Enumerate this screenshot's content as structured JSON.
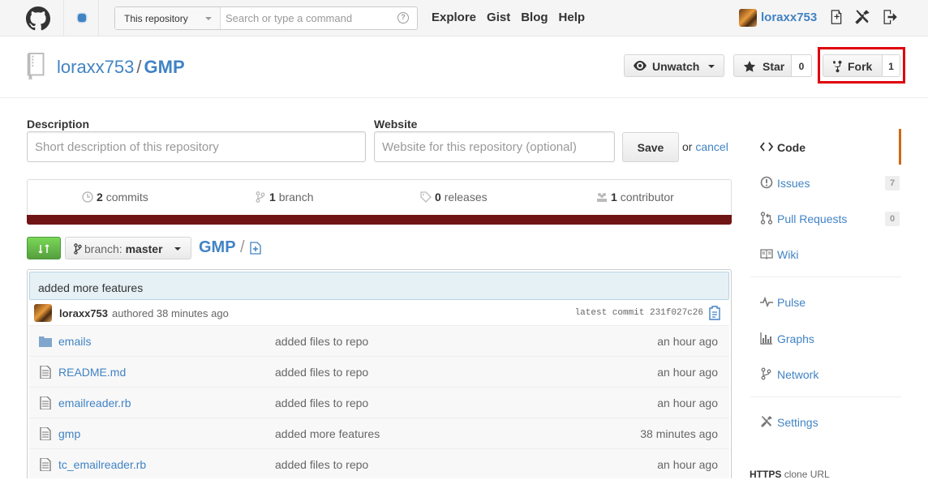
{
  "topbar": {
    "search_scope": "This repository",
    "search_placeholder": "Search or type a command",
    "nav": [
      "Explore",
      "Gist",
      "Blog",
      "Help"
    ],
    "username": "loraxx753"
  },
  "repo": {
    "owner": "loraxx753",
    "separator": "/",
    "name": "GMP",
    "unwatch_label": "Unwatch",
    "star_label": "Star",
    "star_count": "0",
    "fork_label": "Fork",
    "fork_count": "1"
  },
  "form": {
    "description_label": "Description",
    "description_placeholder": "Short description of this repository",
    "website_label": "Website",
    "website_placeholder": "Website for this repository (optional)",
    "save_label": "Save",
    "or_text": "or",
    "cancel_label": "cancel"
  },
  "stats": {
    "commits_count": "2",
    "commits_label": "commits",
    "branch_count": "1",
    "branch_label": "branch",
    "releases_count": "0",
    "releases_label": "releases",
    "contributor_count": "1",
    "contributor_label": "contributor"
  },
  "language_bar_color": "#701516",
  "branch": {
    "prefix": "branch:",
    "name": "master",
    "breadcrumb": "GMP",
    "breadcrumb_sep": "/"
  },
  "commit": {
    "message": "added more features",
    "author": "loraxx753",
    "authored": "authored 38 minutes ago",
    "latest": "latest commit 231f027c26"
  },
  "files": [
    {
      "name": "emails",
      "type": "folder",
      "message": "added files to repo",
      "age": "an hour ago"
    },
    {
      "name": "README.md",
      "type": "file",
      "message": "added files to repo",
      "age": "an hour ago"
    },
    {
      "name": "emailreader.rb",
      "type": "file",
      "message": "added files to repo",
      "age": "an hour ago"
    },
    {
      "name": "gmp",
      "type": "file",
      "message": "added more features",
      "age": "38 minutes ago"
    },
    {
      "name": "tc_emailreader.rb",
      "type": "file",
      "message": "added files to repo",
      "age": "an hour ago"
    }
  ],
  "sidebar": {
    "items": [
      {
        "label": "Code",
        "icon": "code-icon"
      },
      {
        "label": "Issues",
        "icon": "issue-icon",
        "count": "7"
      },
      {
        "label": "Pull Requests",
        "icon": "pull-request-icon",
        "count": "0"
      },
      {
        "label": "Wiki",
        "icon": "book-icon"
      },
      {
        "label": "Pulse",
        "icon": "pulse-icon"
      },
      {
        "label": "Graphs",
        "icon": "graph-icon"
      },
      {
        "label": "Network",
        "icon": "network-icon"
      },
      {
        "label": "Settings",
        "icon": "tools-icon"
      }
    ],
    "clone_protocol": "HTTPS",
    "clone_label": "clone URL"
  },
  "colors": {
    "link": "#4183c4",
    "highlight_box": "#e0000b",
    "selected_tab_accent": "#d26911",
    "compare_button": "#6cc644"
  }
}
